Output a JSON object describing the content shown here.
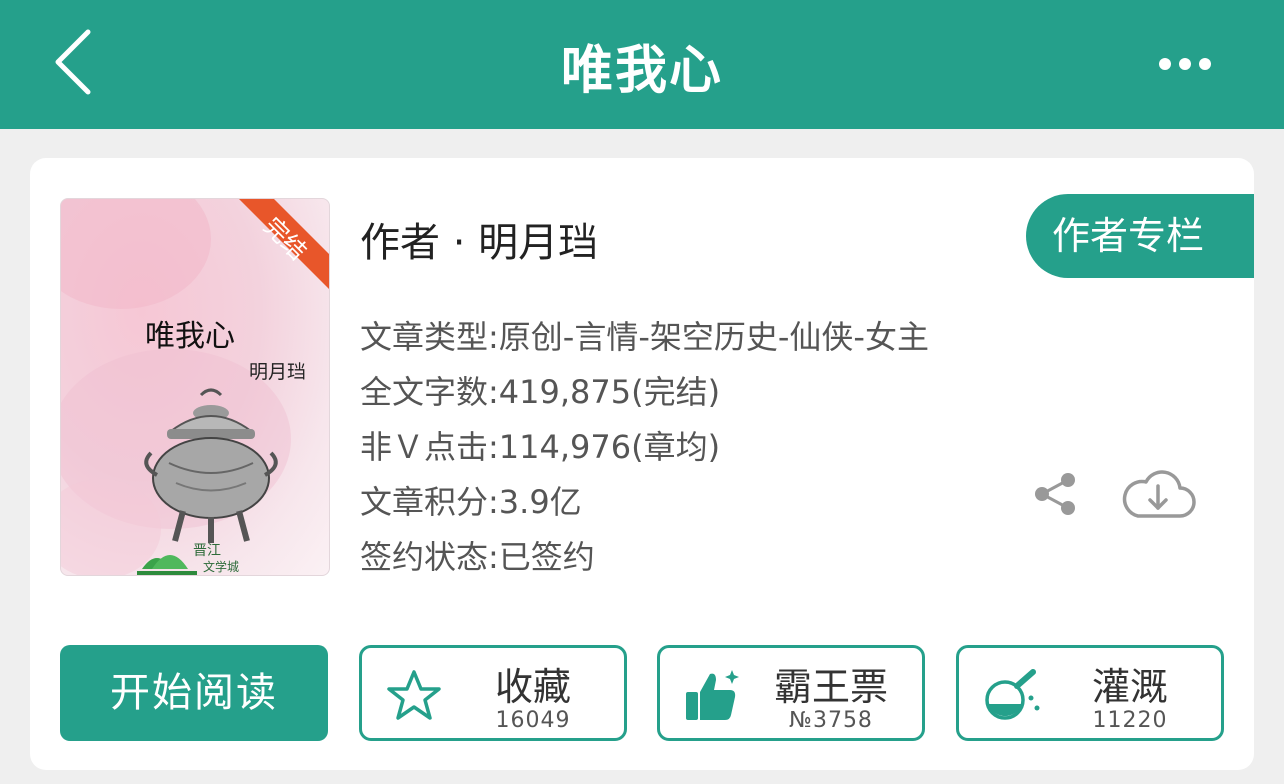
{
  "header": {
    "title": "唯我心",
    "back_icon": "chevron-left-icon",
    "more_icon": "more-dots-icon"
  },
  "book": {
    "cover": {
      "title": "唯我心",
      "author": "明月珰",
      "badge": "完结"
    },
    "author_line": "作者 · 明月珰",
    "author_column_label": "作者专栏",
    "meta": [
      "文章类型:原创-言情-架空历史-仙侠-女主",
      "全文字数:419,875(完结)",
      "非Ｖ点击:114,976(章均)",
      "文章积分:3.9亿",
      "签约状态:已签约"
    ]
  },
  "actions": {
    "read_label": "开始阅读",
    "items": [
      {
        "label": "收藏",
        "count": "16049",
        "icon": "star-icon"
      },
      {
        "label": "霸王票",
        "count": "№3758",
        "icon": "thumbs-up-icon"
      },
      {
        "label": "灌溉",
        "count": "11220",
        "icon": "flask-icon"
      }
    ]
  },
  "colors": {
    "accent": "#25a08b",
    "badge": "#e8562a",
    "background": "#efefef"
  }
}
